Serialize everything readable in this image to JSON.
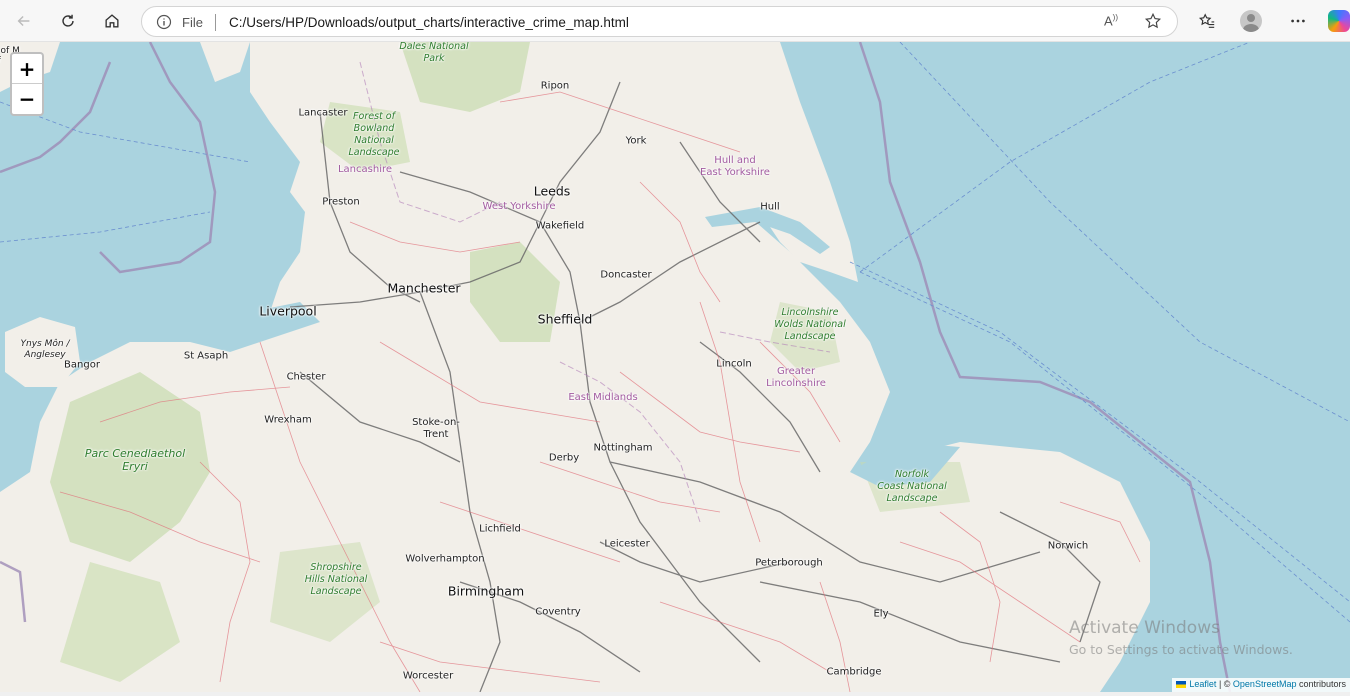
{
  "browser": {
    "address": {
      "scheme_label": "File",
      "url": "C:/Users/HP/Downloads/output_charts/interactive_crime_map.html"
    },
    "icons": [
      "back-arrow-icon",
      "refresh-icon",
      "home-icon",
      "info-icon",
      "read-aloud-icon",
      "favorite-star-icon",
      "favorites-icon",
      "profile-icon",
      "more-icon",
      "copilot-icon"
    ]
  },
  "map": {
    "zoom_in_label": "+",
    "zoom_out_label": "−",
    "labels": {
      "dales": "Dales National\nPark",
      "ripon": "Ripon",
      "lancaster": "Lancaster",
      "forest_bowland": "Forest of\nBowland\nNational\nLandscape",
      "lancashire": "Lancashire",
      "york": "York",
      "hull_ey": "Hull and\nEast Yorkshire",
      "preston": "Preston",
      "leeds": "Leeds",
      "west_yorkshire": "West Yorkshire",
      "wakefield": "Wakefield",
      "hull": "Hull",
      "doncaster": "Doncaster",
      "manchester": "Manchester",
      "liverpool": "Liverpool",
      "sheffield": "Sheffield",
      "lincs_wolds": "Lincolnshire\nWolds National\nLandscape",
      "ynys_mon": "Ynys Môn /\nAnglesey",
      "bangor": "Bangor",
      "st_asaph": "St Asaph",
      "chester": "Chester",
      "lincoln": "Lincoln",
      "greater_lincs": "Greater\nLincolnshire",
      "east_midlands": "East Midlands",
      "wrexham": "Wrexham",
      "stoke": "Stoke-on-\nTrent",
      "nottingham": "Nottingham",
      "derby": "Derby",
      "eryri": "Parc Cenedlaethol\nEryri",
      "norfolk_coast": "Norfolk\nCoast National\nLandscape",
      "lichfield": "Lichfield",
      "leicester": "Leicester",
      "norwich": "Norwich",
      "wolverhampton": "Wolverhampton",
      "peterborough": "Peterborough",
      "shropshire": "Shropshire\nHills National\nLandscape",
      "birmingham": "Birmingham",
      "coventry": "Coventry",
      "ely": "Ely",
      "cambridge": "Cambridge",
      "worcester": "Worcester",
      "top_left_partial": "e of M\nof"
    },
    "attribution": {
      "leaflet": "Leaflet",
      "separator": " | © ",
      "osm": "OpenStreetMap",
      "contributors": " contributors"
    }
  },
  "os_overlay": {
    "line1": "Activate Windows",
    "line2": "Go to Settings to activate Windows."
  },
  "colors": {
    "sea": "#aad3df",
    "land": "#f2efe9",
    "park_green": "#c8dcae",
    "road_red": "#e0707a",
    "road_grey": "#6a6a6a",
    "boundary": "#9e8bb5",
    "link": "#0078a8"
  }
}
